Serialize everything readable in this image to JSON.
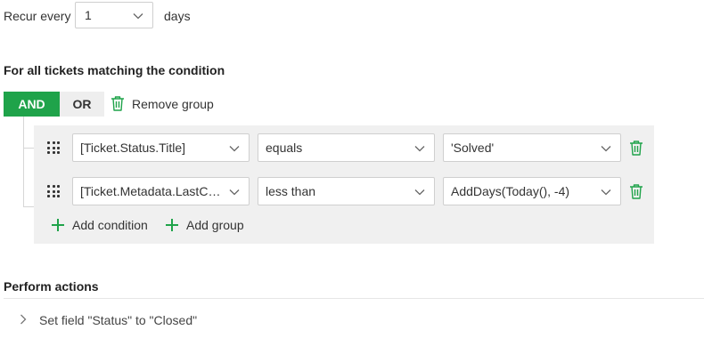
{
  "recur": {
    "label": "Recur every",
    "value": "1",
    "unit": "days"
  },
  "conditions_heading": "For all tickets matching the condition",
  "group": {
    "and_label": "AND",
    "or_label": "OR",
    "remove_label": "Remove group",
    "active_operator": "AND",
    "conditions": [
      {
        "field": "[Ticket.Status.Title]",
        "operator": "equals",
        "value": "'Solved'"
      },
      {
        "field": "[Ticket.Metadata.LastCo...",
        "operator": "less than",
        "value": "AddDays(Today(), -4)"
      }
    ],
    "add_condition_label": "Add condition",
    "add_group_label": "Add group"
  },
  "actions": {
    "heading": "Perform actions",
    "items": [
      {
        "label": "Set field \"Status\" to \"Closed\""
      }
    ]
  },
  "colors": {
    "accent": "#1fa34a",
    "panel": "#f0f0f0",
    "border": "#cfcfcf"
  }
}
